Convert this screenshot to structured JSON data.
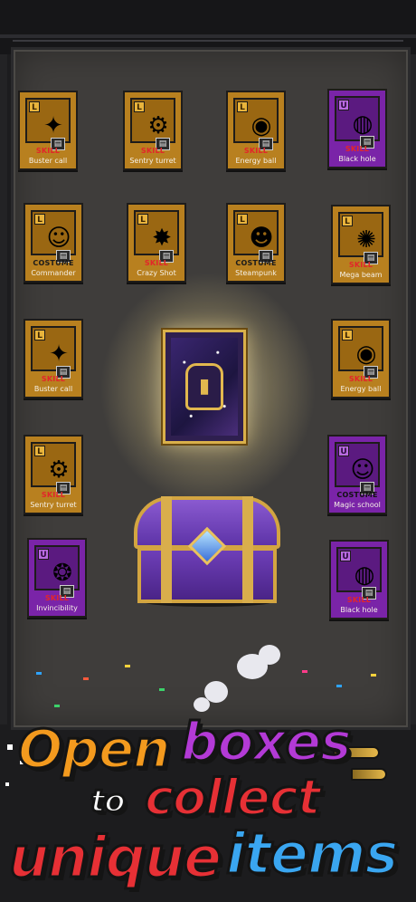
{
  "colors": {
    "legendary_card": "#b8801f",
    "unique_card": "#7a24a8",
    "skill_text": "#e2262a",
    "slogan_orange": "#f39a1e",
    "slogan_purple": "#b33ad6",
    "slogan_red": "#e63035",
    "slogan_blue": "#3aa6f0"
  },
  "cards": [
    {
      "grade": "L",
      "rarity": "legendary",
      "type": "SKILL",
      "name": "Buster call",
      "icon": "✦"
    },
    {
      "grade": "L",
      "rarity": "legendary",
      "type": "SKILL",
      "name": "Sentry turret",
      "icon": "⚙"
    },
    {
      "grade": "L",
      "rarity": "legendary",
      "type": "SKILL",
      "name": "Energy ball",
      "icon": "◉"
    },
    {
      "grade": "U",
      "rarity": "unique",
      "type": "SKILL",
      "name": "Black hole",
      "icon": "◍"
    },
    {
      "grade": "L",
      "rarity": "legendary",
      "type": "COSTUME",
      "name": "Commander",
      "icon": "☺"
    },
    {
      "grade": "L",
      "rarity": "legendary",
      "type": "SKILL",
      "name": "Crazy Shot",
      "icon": "✸"
    },
    {
      "grade": "L",
      "rarity": "legendary",
      "type": "COSTUME",
      "name": "Steampunk",
      "icon": "☻"
    },
    {
      "grade": "L",
      "rarity": "legendary",
      "type": "SKILL",
      "name": "Mega beam",
      "icon": "✺"
    },
    {
      "grade": "L",
      "rarity": "legendary",
      "type": "SKILL",
      "name": "Buster call",
      "icon": "✦"
    },
    {
      "grade": "L",
      "rarity": "legendary",
      "type": "SKILL",
      "name": "Energy ball",
      "icon": "◉"
    },
    {
      "grade": "L",
      "rarity": "legendary",
      "type": "SKILL",
      "name": "Sentry turret",
      "icon": "⚙"
    },
    {
      "grade": "U",
      "rarity": "unique",
      "type": "COSTUME",
      "name": "Magic school",
      "icon": "☺"
    },
    {
      "grade": "U",
      "rarity": "unique",
      "type": "SKILL",
      "name": "Invincibility",
      "icon": "❂"
    },
    {
      "grade": "U",
      "rarity": "unique",
      "type": "SKILL",
      "name": "Black hole",
      "icon": "◍"
    }
  ],
  "slogan": {
    "open": "Open",
    "boxes": "boxes",
    "to": "to",
    "collect": "collect",
    "unique": "unique",
    "items": "items"
  }
}
